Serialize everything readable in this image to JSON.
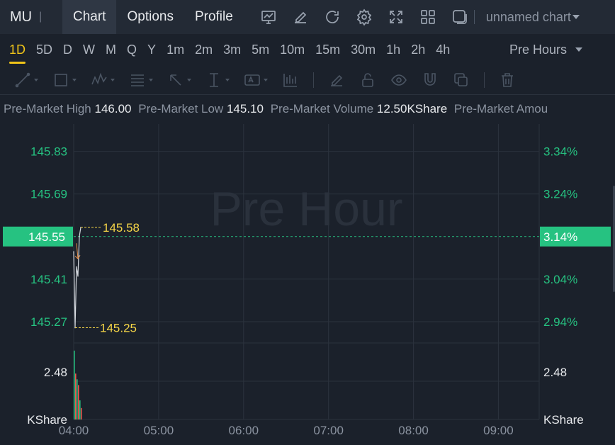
{
  "header": {
    "symbol": "MU",
    "tabs": [
      {
        "label": "Chart",
        "active": true
      },
      {
        "label": "Options",
        "active": false
      },
      {
        "label": "Profile",
        "active": false
      }
    ],
    "icons": [
      "indicators-icon",
      "draw-icon",
      "refresh-icon",
      "settings-icon",
      "fullscreen-icon",
      "layout-icon",
      "snapshot-icon"
    ],
    "chart_name": "unnamed chart"
  },
  "intervals": {
    "items": [
      "1D",
      "5D",
      "D",
      "W",
      "M",
      "Q",
      "Y",
      "1m",
      "2m",
      "3m",
      "5m",
      "10m",
      "15m",
      "30m",
      "1h",
      "2h",
      "4h"
    ],
    "active": "1D",
    "session": "Pre Hours"
  },
  "tools": [
    "trend-line-icon",
    "rectangle-icon",
    "pattern-icon",
    "fib-icon",
    "arrow-icon",
    "measure-icon",
    "text-icon",
    "bar-pattern-icon",
    "brush-icon",
    "lock-icon",
    "eye-icon",
    "magnet-icon",
    "clone-icon",
    "trash-icon"
  ],
  "info": [
    {
      "label": "Pre-Market High",
      "value": "146.00"
    },
    {
      "label": "Pre-Market Low",
      "value": "145.10"
    },
    {
      "label": "Pre-Market Volume",
      "value": "12.50KShare"
    },
    {
      "label": "Pre-Market Amou",
      "value": ""
    }
  ],
  "colors": {
    "up": "#26c281",
    "down": "#e8584f",
    "marker": "#f5d547",
    "grid": "#2b323d",
    "background": "#1b212b"
  },
  "chart_data": {
    "type": "line",
    "watermark": "Pre Hour",
    "y_ticks": [
      145.83,
      145.69,
      145.55,
      145.41,
      145.27
    ],
    "y_ticks_pct": [
      "3.34%",
      "3.24%",
      "3.14%",
      "3.04%",
      "2.94%"
    ],
    "last_price": "145.55",
    "last_pct": "3.14%",
    "high_marker": "145.58",
    "low_marker": "145.25",
    "ylim": [
      145.2,
      145.92
    ],
    "x_ticks": [
      "04:00",
      "05:00",
      "06:00",
      "07:00",
      "08:00",
      "09:00"
    ],
    "x_start_hour": 4,
    "x_end_hour": 9.48,
    "price_series": {
      "x": [
        "04:00",
        "04:01",
        "04:02",
        "04:03",
        "04:04",
        "04:05"
      ],
      "values": [
        145.5,
        145.25,
        145.45,
        145.42,
        145.55,
        145.58
      ]
    },
    "volume": {
      "tick": "2.48",
      "unit": "KShare",
      "ymax": 4.0,
      "bars": [
        {
          "x": "04:00",
          "value": 3.6,
          "dir": "up"
        },
        {
          "x": "04:01",
          "value": 2.4,
          "dir": "down"
        },
        {
          "x": "04:02",
          "value": 2.1,
          "dir": "up"
        },
        {
          "x": "04:03",
          "value": 1.8,
          "dir": "down"
        },
        {
          "x": "04:04",
          "value": 1.0,
          "dir": "up"
        },
        {
          "x": "04:05",
          "value": 0.6,
          "dir": "down"
        }
      ]
    }
  }
}
